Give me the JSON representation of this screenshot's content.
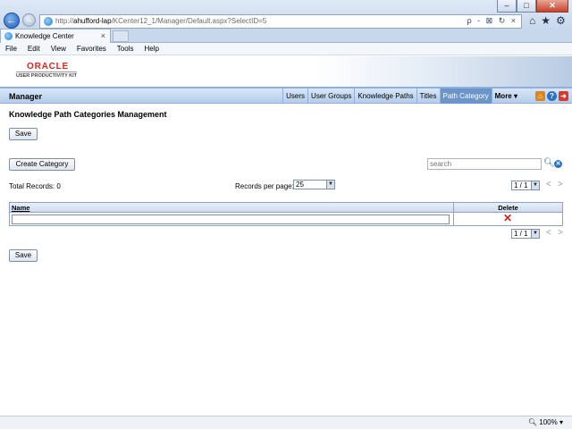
{
  "browser": {
    "url_prefix": "http://",
    "url_host": "ahufford-lap",
    "url_path": "/KCenter12_1/Manager/Default.aspx?SelectID=5",
    "address_tools": "ρ - ⊠ ↻ ×",
    "tab_title": "Knowledge Center",
    "menu": [
      "File",
      "Edit",
      "View",
      "Favorites",
      "Tools",
      "Help"
    ],
    "zoom": "100%"
  },
  "logo": {
    "brand": "ORACLE",
    "product": "USER PRODUCTIVITY KIT"
  },
  "navbar": {
    "title": "Manager",
    "links": [
      "Users",
      "User Groups",
      "Knowledge Paths",
      "Titles",
      "Path Category",
      "More ▾"
    ],
    "active_index": 4
  },
  "page": {
    "heading": "Knowledge Path Categories Management",
    "save_label": "Save",
    "create_category_label": "Create Category",
    "search_placeholder": "search",
    "total_records": "Total Records: 0",
    "records_per_page_label": "Records per page:",
    "records_per_page_value": "25",
    "page_selector": "1 / 1",
    "pager_prev": "<",
    "pager_next": ">"
  },
  "grid": {
    "columns": [
      "Name",
      "Delete"
    ],
    "rows": [
      {
        "name": "",
        "delete": "✕"
      }
    ]
  }
}
